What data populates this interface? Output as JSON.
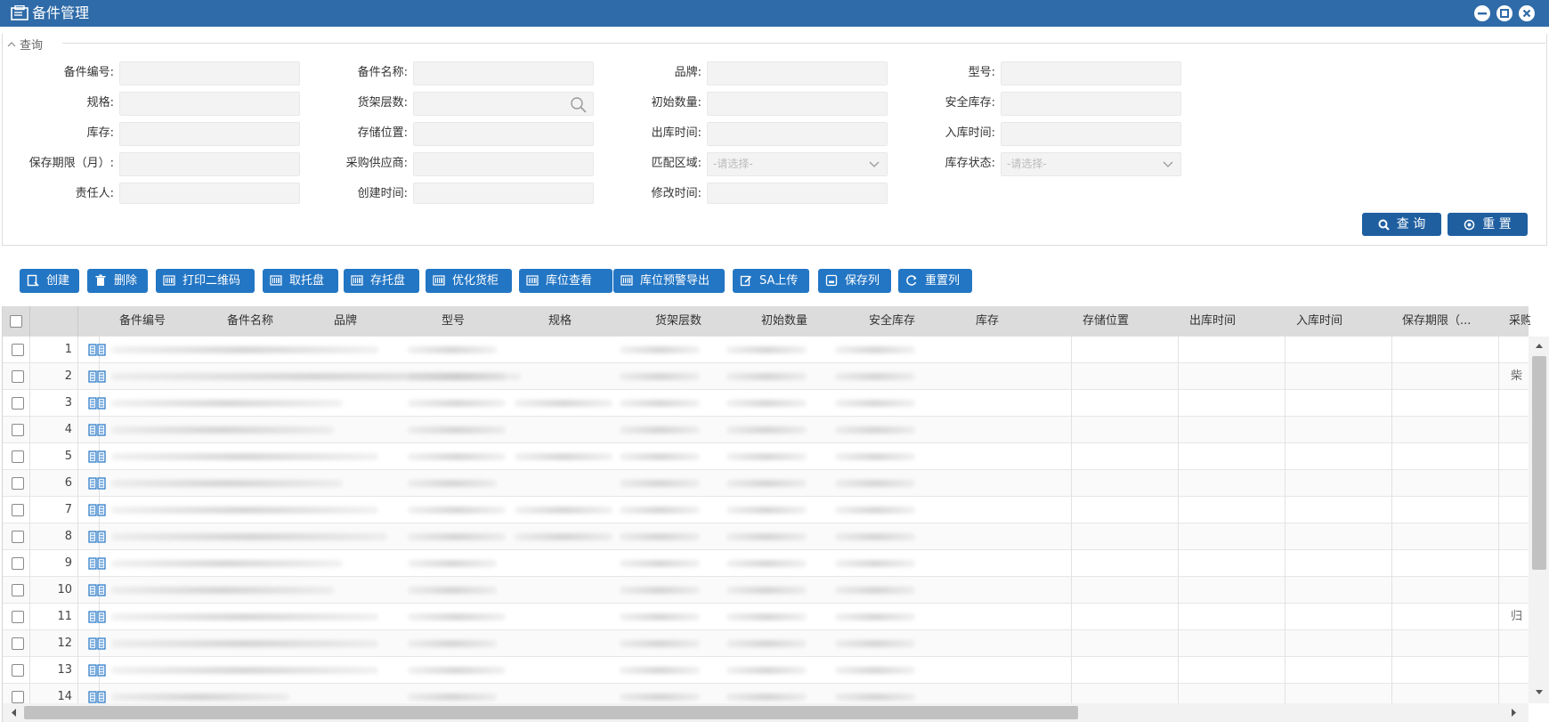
{
  "window": {
    "title": "备件管理"
  },
  "query": {
    "legend": "查询",
    "fields": [
      {
        "label": "备件编号:",
        "value": ""
      },
      {
        "label": "备件名称:",
        "value": ""
      },
      {
        "label": "品牌:",
        "value": ""
      },
      {
        "label": "型号:",
        "value": ""
      },
      {
        "label": "规格:",
        "value": ""
      },
      {
        "label": "货架层数:",
        "value": ""
      },
      {
        "label": "初始数量:",
        "value": ""
      },
      {
        "label": "安全库存:",
        "value": ""
      },
      {
        "label": "库存:",
        "value": ""
      },
      {
        "label": "存储位置:",
        "value": ""
      },
      {
        "label": "出库时间:",
        "value": ""
      },
      {
        "label": "入库时间:",
        "value": ""
      },
      {
        "label": "保存期限（月）:",
        "value": ""
      },
      {
        "label": "采购供应商:",
        "value": ""
      },
      {
        "label": "匹配区域:",
        "placeholder": "-请选择-"
      },
      {
        "label": "库存状态:",
        "placeholder": "-请选择-"
      },
      {
        "label": "责任人:",
        "value": ""
      },
      {
        "label": "创建时间:",
        "value": ""
      },
      {
        "label": "修改时间:",
        "value": ""
      }
    ],
    "search_label": "查 询",
    "reset_label": "重 置"
  },
  "toolbar": {
    "buttons": [
      {
        "label": "创建",
        "icon": "create-icon"
      },
      {
        "label": "删除",
        "icon": "trash-icon"
      },
      {
        "label": "打印二维码",
        "icon": "barcode-icon"
      },
      {
        "label": "取托盘",
        "icon": "barcode-icon"
      },
      {
        "label": "存托盘",
        "icon": "barcode-icon"
      },
      {
        "label": "优化货柜",
        "icon": "barcode-icon"
      },
      {
        "label": "库位查看",
        "icon": "barcode-icon"
      },
      {
        "label": "库位预警导出",
        "icon": "barcode-icon"
      },
      {
        "label": "SA上传",
        "icon": "edit-icon"
      },
      {
        "label": "保存列",
        "icon": "save-icon"
      },
      {
        "label": "重置列",
        "icon": "refresh-icon"
      }
    ]
  },
  "grid": {
    "columns": [
      "备件编号",
      "备件名称",
      "品牌",
      "型号",
      "规格",
      "货架层数",
      "初始数量",
      "安全库存",
      "库存",
      "存储位置",
      "出库时间",
      "入库时间",
      "保存期限（...",
      "采购供"
    ],
    "row_numbers": [
      "1",
      "2",
      "3",
      "4",
      "5",
      "6",
      "7",
      "8",
      "9",
      "10",
      "11",
      "12",
      "13",
      "14"
    ],
    "overflow_cells": {
      "2": "柴",
      "11": "归"
    }
  },
  "colors": {
    "titlebar": "#2f6ba8",
    "toolbar_button": "#2376c4",
    "query_button": "#1f5fa0"
  }
}
